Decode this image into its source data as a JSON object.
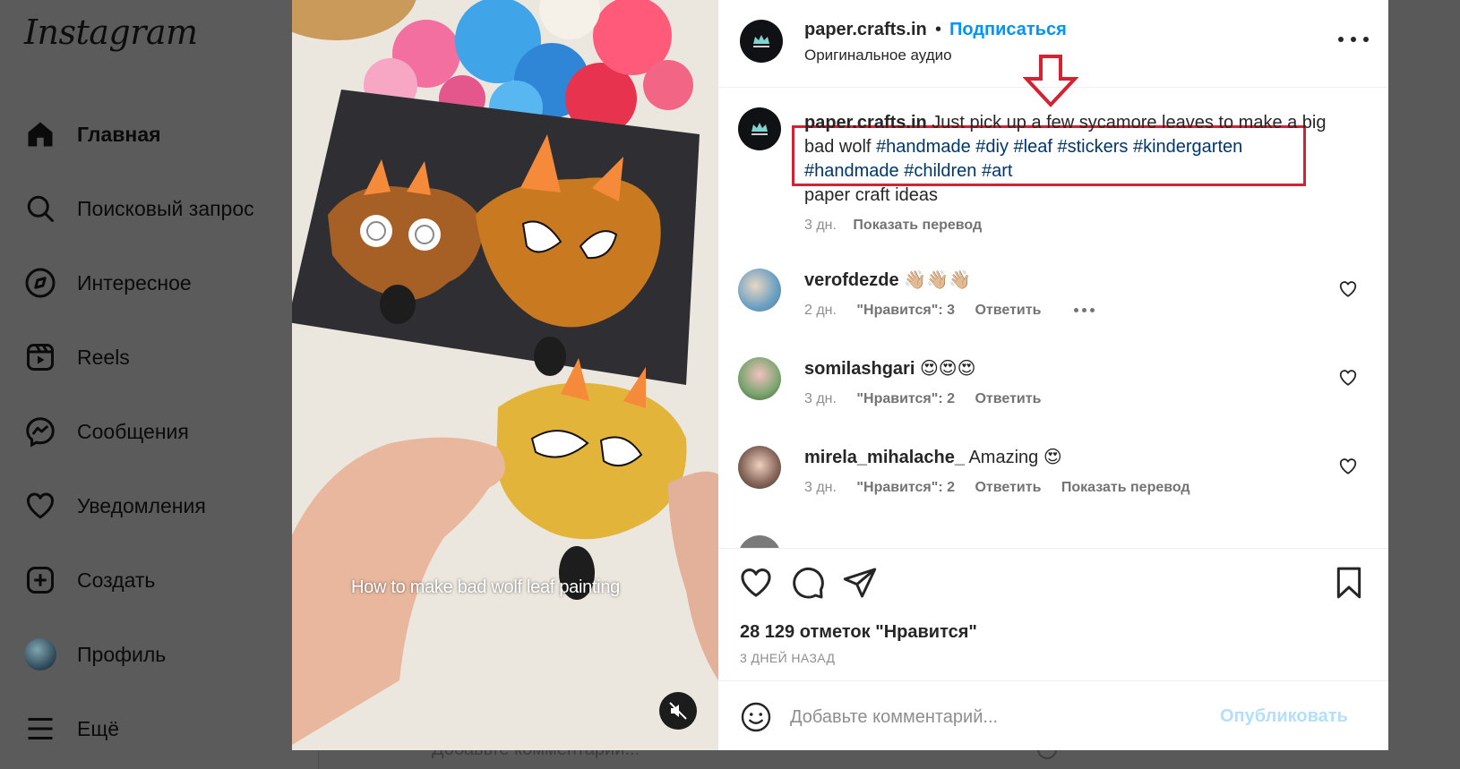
{
  "sidebar": {
    "logo": "Instagram",
    "items": [
      {
        "label": "Главная",
        "icon": "home-icon"
      },
      {
        "label": "Поисковый запрос",
        "icon": "search-icon"
      },
      {
        "label": "Интересное",
        "icon": "compass-icon"
      },
      {
        "label": "Reels",
        "icon": "reels-icon"
      },
      {
        "label": "Сообщения",
        "icon": "messenger-icon"
      },
      {
        "label": "Уведомления",
        "icon": "heart-icon"
      },
      {
        "label": "Создать",
        "icon": "plus-square-icon"
      },
      {
        "label": "Профиль",
        "icon": "profile-avatar"
      },
      {
        "label": "Ещё",
        "icon": "menu-icon"
      }
    ]
  },
  "background": {
    "comment_placeholder": "Добавьте комментарий..."
  },
  "media": {
    "overlay_text": "How to make bad wolf leaf painting"
  },
  "post": {
    "header": {
      "username": "paper.crafts.in",
      "separator": "•",
      "follow": "Подписаться",
      "audio": "Оригинальное аудио"
    },
    "caption": {
      "username": "paper.crafts.in",
      "text": "Just pick up a few sycamore leaves to make a big bad wolf",
      "hashtags": [
        "#handmade",
        "#diy",
        "#leaf",
        "#stickers",
        "#kindergarten",
        "#handmade",
        "#children",
        "#art"
      ],
      "line2": "paper craft ideas",
      "time": "3 дн.",
      "translate": "Показать перевод"
    },
    "comments": [
      {
        "username": "verofdezde",
        "text": "👋🏼👋🏼👋🏼",
        "time": "2 дн.",
        "likes": "\"Нравится\": 3",
        "reply": "Ответить"
      },
      {
        "username": "somilashgari",
        "text": "😍😍😍",
        "time": "3 дн.",
        "likes": "\"Нравится\": 2",
        "reply": "Ответить"
      },
      {
        "username": "mirela_mihalache_",
        "text": "Amazing 😍",
        "time": "3 дн.",
        "likes": "\"Нравится\": 2",
        "reply": "Ответить",
        "translate": "Показать перевод"
      }
    ],
    "likes_count": "28 129 отметок \"Нравится\"",
    "timestamp": "3 ДНЕЙ НАЗАД",
    "comment_box": {
      "placeholder": "Добавьте комментарий...",
      "publish": "Опубликовать"
    }
  },
  "colors": {
    "link_blue": "#0095f6",
    "hashtag": "#00376b",
    "annotation_red": "#d32232"
  }
}
